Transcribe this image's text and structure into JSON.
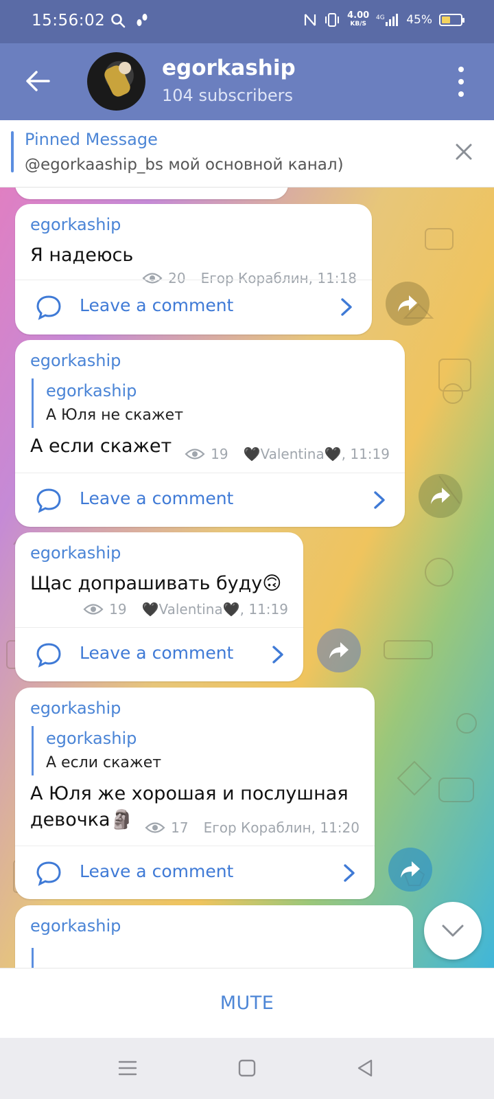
{
  "status_bar": {
    "time": "15:56:02",
    "net_speed": "4.00",
    "net_unit": "KB/S",
    "network": "4G",
    "battery": "45%",
    "battery_level": 0.45
  },
  "header": {
    "title": "egorkaship",
    "subtitle": "104 subscribers"
  },
  "pinned": {
    "label": "Pinned Message",
    "text": "@egorkaaship_bs мой основной канал)"
  },
  "messages": [
    {
      "author": "egorkaship",
      "text": "Я надеюсь",
      "views": "20",
      "signature": "Егор Кораблин, 11:18",
      "comment_label": "Leave a comment"
    },
    {
      "author": "egorkaship",
      "quote_author": "egorkaship",
      "quote_text": "А Юля не скажет",
      "text": "А если скажет",
      "views": "19",
      "signature": "🖤Valentina🖤, 11:19",
      "comment_label": "Leave a comment"
    },
    {
      "author": "egorkaship",
      "text": "Щас допрашивать буду🙃",
      "views": "19",
      "signature": "🖤Valentina🖤, 11:19",
      "comment_label": "Leave a comment"
    },
    {
      "author": "egorkaship",
      "quote_author": "egorkaship",
      "quote_text": "А если скажет",
      "text_line1": "А Юля же хорошая и послушная",
      "text_line2": "девочка🗿",
      "views": "17",
      "signature": "Егор Кораблин, 11:20",
      "comment_label": "Leave a comment"
    },
    {
      "author": "egorkaship"
    }
  ],
  "bottom": {
    "mute_label": "MUTE"
  },
  "colors": {
    "header": "#6b7fbf",
    "status_bar": "#5a6ba6",
    "accent": "#4d86d6"
  }
}
